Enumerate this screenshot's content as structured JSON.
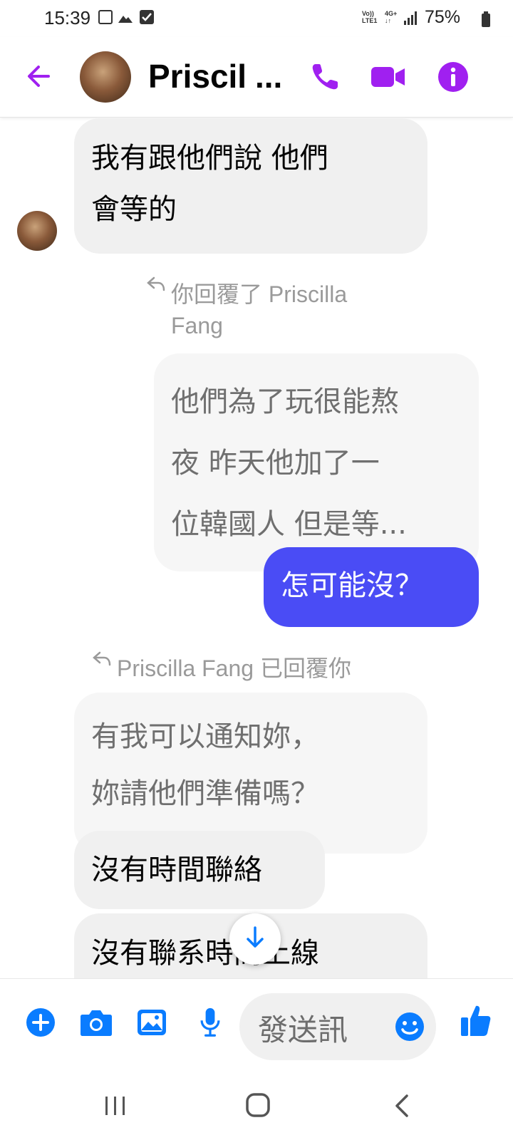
{
  "status_bar": {
    "time": "15:39",
    "network_top": "Vo))",
    "network_bottom": "LTE1",
    "signal_top": "4G+",
    "signal_bottom": "↓↑",
    "battery": "75%"
  },
  "header": {
    "contact_name": "Priscil",
    "contact_name_ellipsis": "...",
    "accent_color": "#a020f0"
  },
  "messages": [
    {
      "lines": [
        "我有跟他們說 他們",
        "會等的"
      ]
    },
    {
      "reply_label_lines": [
        "你回覆了 Priscilla",
        "Fang"
      ],
      "lines": [
        "他們為了玩很能熬",
        "夜 昨天他加了一",
        "位韓國人 但是等..."
      ]
    },
    {
      "text": "怎可能沒？",
      "color": "#4a4cf5"
    },
    {
      "reply_label": "Priscilla Fang 已回覆你",
      "lines": [
        "有我可以通知妳，",
        "妳請他們準備嗎？"
      ]
    },
    {
      "text": "沒有時間聯絡"
    },
    {
      "text": "沒有聯系時間上線"
    }
  ],
  "composer": {
    "placeholder": "發送訊",
    "icon_color": "#0a7cff"
  },
  "icons": [
    "back-arrow-icon",
    "phone-icon",
    "video-camera-icon",
    "info-icon",
    "reply-arrow-icon",
    "scroll-down-icon",
    "plus-icon",
    "camera-icon",
    "image-icon",
    "microphone-icon",
    "emoji-icon",
    "thumbs-up-icon",
    "recent-apps-icon",
    "home-icon",
    "nav-back-icon"
  ]
}
